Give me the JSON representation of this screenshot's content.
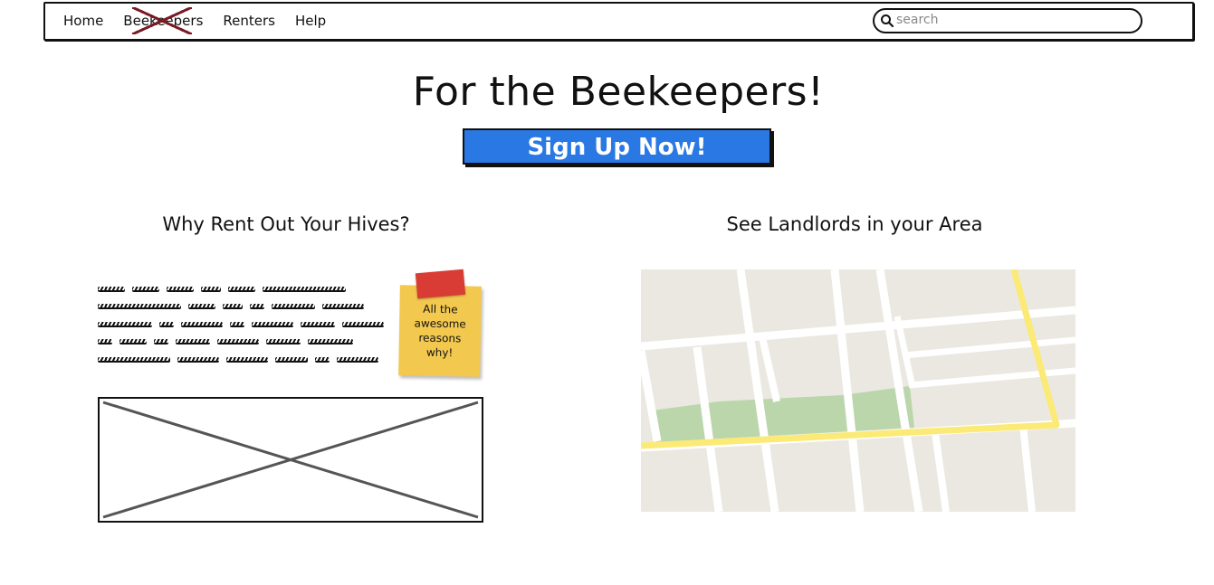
{
  "navbar": {
    "links": [
      {
        "label": "Home"
      },
      {
        "label": "Beekeepers",
        "crossed_out": true
      },
      {
        "label": "Renters"
      },
      {
        "label": "Help"
      }
    ],
    "search": {
      "placeholder": "search",
      "value": ""
    }
  },
  "hero": {
    "title": "For the Beekeepers!",
    "signup_label": "Sign Up Now!"
  },
  "why_section": {
    "heading": "Why Rent Out Your Hives?",
    "sticky_note": [
      "All the",
      "awesome",
      "reasons",
      "why!"
    ]
  },
  "map_section": {
    "heading": "See Landlords in your Area"
  },
  "colors": {
    "button_blue": "#2a78e4",
    "sticky_yellow": "#f3c84f",
    "tape_red": "#d93b35",
    "crossout": "#7a1a24",
    "map_bg": "#ebe8e1",
    "map_park": "#bcd6ac",
    "map_highway": "#fbea76"
  },
  "icons": {
    "search": "search-icon"
  }
}
